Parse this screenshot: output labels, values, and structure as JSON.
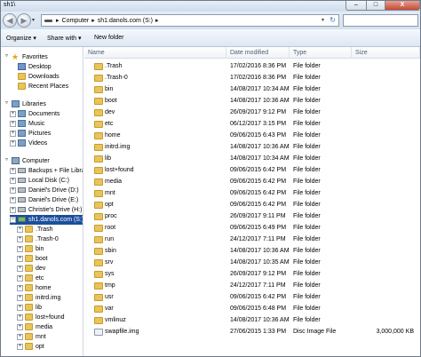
{
  "window": {
    "title": "sh1\\",
    "minimize_label": "–",
    "maximize_label": "□",
    "close_label": "X"
  },
  "address": {
    "crumbs": [
      "▸",
      "Computer",
      "▸",
      "sh1.danols.com (S:)",
      "▸"
    ],
    "dropdown_label": "▾",
    "refresh_label": "↻"
  },
  "nav_buttons": {
    "back_label": "◀",
    "forward_label": "▶",
    "recent_label": "▾"
  },
  "toolbar": {
    "organize": "Organize ▾",
    "share_with": "Share with ▾",
    "new_folder": "New folder"
  },
  "columns": {
    "name": "Name",
    "date": "Date modified",
    "type": "Type",
    "size": "Size"
  },
  "tree": [
    {
      "label": "Favorites",
      "icon": "star",
      "toggle": "▿",
      "indent": 0
    },
    {
      "label": "Desktop",
      "icon": "blue",
      "indent": 1
    },
    {
      "label": "Downloads",
      "icon": "folder",
      "indent": 1
    },
    {
      "label": "Recent Places",
      "icon": "folder",
      "indent": 1
    },
    {
      "label": "Libraries",
      "icon": "lib",
      "toggle": "▿",
      "indent": 0
    },
    {
      "label": "Documents",
      "icon": "lib",
      "toggle": "+",
      "indent": 1
    },
    {
      "label": "Music",
      "icon": "lib",
      "toggle": "+",
      "indent": 1
    },
    {
      "label": "Pictures",
      "icon": "lib",
      "toggle": "+",
      "indent": 1
    },
    {
      "label": "Videos",
      "icon": "lib",
      "toggle": "+",
      "indent": 1
    },
    {
      "label": "Computer",
      "icon": "comp",
      "toggle": "▿",
      "indent": 0
    },
    {
      "label": "Backups + File Library",
      "icon": "drive",
      "toggle": "+",
      "indent": 1
    },
    {
      "label": "Local Disk (C:)",
      "icon": "drive",
      "toggle": "+",
      "indent": 1
    },
    {
      "label": "Daniel's Drive (D:)",
      "icon": "drive",
      "toggle": "+",
      "indent": 1
    },
    {
      "label": "Daniel's Drive (E:)",
      "icon": "drive",
      "toggle": "+",
      "indent": 1
    },
    {
      "label": "Christie's Drive (H:)",
      "icon": "drive",
      "toggle": "+",
      "indent": 1
    },
    {
      "label": "sh1.danols.com (S:)",
      "icon": "net",
      "toggle": "–",
      "indent": 1,
      "selected": true
    },
    {
      "label": ".Trash",
      "icon": "folder",
      "toggle": "+",
      "indent": 2
    },
    {
      "label": ".Trash-0",
      "icon": "folder",
      "toggle": "+",
      "indent": 2
    },
    {
      "label": "bin",
      "icon": "folder",
      "toggle": "+",
      "indent": 2
    },
    {
      "label": "boot",
      "icon": "folder",
      "toggle": "+",
      "indent": 2
    },
    {
      "label": "dev",
      "icon": "folder",
      "toggle": "+",
      "indent": 2
    },
    {
      "label": "etc",
      "icon": "folder",
      "toggle": "+",
      "indent": 2
    },
    {
      "label": "home",
      "icon": "folder",
      "toggle": "+",
      "indent": 2
    },
    {
      "label": "initrd.img",
      "icon": "folder",
      "toggle": "+",
      "indent": 2
    },
    {
      "label": "lib",
      "icon": "folder",
      "toggle": "+",
      "indent": 2
    },
    {
      "label": "lost+found",
      "icon": "folder",
      "toggle": "+",
      "indent": 2
    },
    {
      "label": "media",
      "icon": "folder",
      "toggle": "+",
      "indent": 2
    },
    {
      "label": "mnt",
      "icon": "folder",
      "toggle": "+",
      "indent": 2
    },
    {
      "label": "opt",
      "icon": "folder",
      "toggle": "+",
      "indent": 2
    }
  ],
  "files": [
    {
      "name": ".Trash",
      "date": "17/02/2016 8:36 PM",
      "type": "File folder",
      "size": "",
      "icon": "folder"
    },
    {
      "name": ".Trash-0",
      "date": "17/02/2016 8:36 PM",
      "type": "File folder",
      "size": "",
      "icon": "folder"
    },
    {
      "name": "bin",
      "date": "14/08/2017 10:34 AM",
      "type": "File folder",
      "size": "",
      "icon": "folder"
    },
    {
      "name": "boot",
      "date": "14/08/2017 10:36 AM",
      "type": "File folder",
      "size": "",
      "icon": "folder"
    },
    {
      "name": "dev",
      "date": "26/09/2017 9:12 PM",
      "type": "File folder",
      "size": "",
      "icon": "folder"
    },
    {
      "name": "etc",
      "date": "06/12/2017 3:15 PM",
      "type": "File folder",
      "size": "",
      "icon": "folder"
    },
    {
      "name": "home",
      "date": "09/06/2015 6:43 PM",
      "type": "File folder",
      "size": "",
      "icon": "folder"
    },
    {
      "name": "initrd.img",
      "date": "14/08/2017 10:36 AM",
      "type": "File folder",
      "size": "",
      "icon": "folder"
    },
    {
      "name": "lib",
      "date": "14/08/2017 10:34 AM",
      "type": "File folder",
      "size": "",
      "icon": "folder"
    },
    {
      "name": "lost+found",
      "date": "09/06/2015 6:42 PM",
      "type": "File folder",
      "size": "",
      "icon": "folder"
    },
    {
      "name": "media",
      "date": "09/06/2015 6:42 PM",
      "type": "File folder",
      "size": "",
      "icon": "folder"
    },
    {
      "name": "mnt",
      "date": "09/06/2015 6:42 PM",
      "type": "File folder",
      "size": "",
      "icon": "folder"
    },
    {
      "name": "opt",
      "date": "09/06/2015 6:42 PM",
      "type": "File folder",
      "size": "",
      "icon": "folder"
    },
    {
      "name": "proc",
      "date": "26/09/2017 9:11 PM",
      "type": "File folder",
      "size": "",
      "icon": "folder"
    },
    {
      "name": "root",
      "date": "09/06/2015 6:49 PM",
      "type": "File folder",
      "size": "",
      "icon": "folder"
    },
    {
      "name": "run",
      "date": "24/12/2017 7:11 PM",
      "type": "File folder",
      "size": "",
      "icon": "folder"
    },
    {
      "name": "sbin",
      "date": "14/08/2017 10:36 AM",
      "type": "File folder",
      "size": "",
      "icon": "folder"
    },
    {
      "name": "srv",
      "date": "14/08/2017 10:35 AM",
      "type": "File folder",
      "size": "",
      "icon": "folder"
    },
    {
      "name": "sys",
      "date": "26/09/2017 9:12 PM",
      "type": "File folder",
      "size": "",
      "icon": "folder"
    },
    {
      "name": "tmp",
      "date": "24/12/2017 7:11 PM",
      "type": "File folder",
      "size": "",
      "icon": "folder"
    },
    {
      "name": "usr",
      "date": "09/06/2015 6:42 PM",
      "type": "File folder",
      "size": "",
      "icon": "folder"
    },
    {
      "name": "var",
      "date": "09/06/2015 6:48 PM",
      "type": "File folder",
      "size": "",
      "icon": "folder"
    },
    {
      "name": "vmlinuz",
      "date": "14/08/2017 10:36 AM",
      "type": "File folder",
      "size": "",
      "icon": "folder"
    },
    {
      "name": "swapfile.img",
      "date": "27/06/2015 1:33 PM",
      "type": "Disc Image File",
      "size": "3,000,000 KB",
      "icon": "image"
    }
  ]
}
